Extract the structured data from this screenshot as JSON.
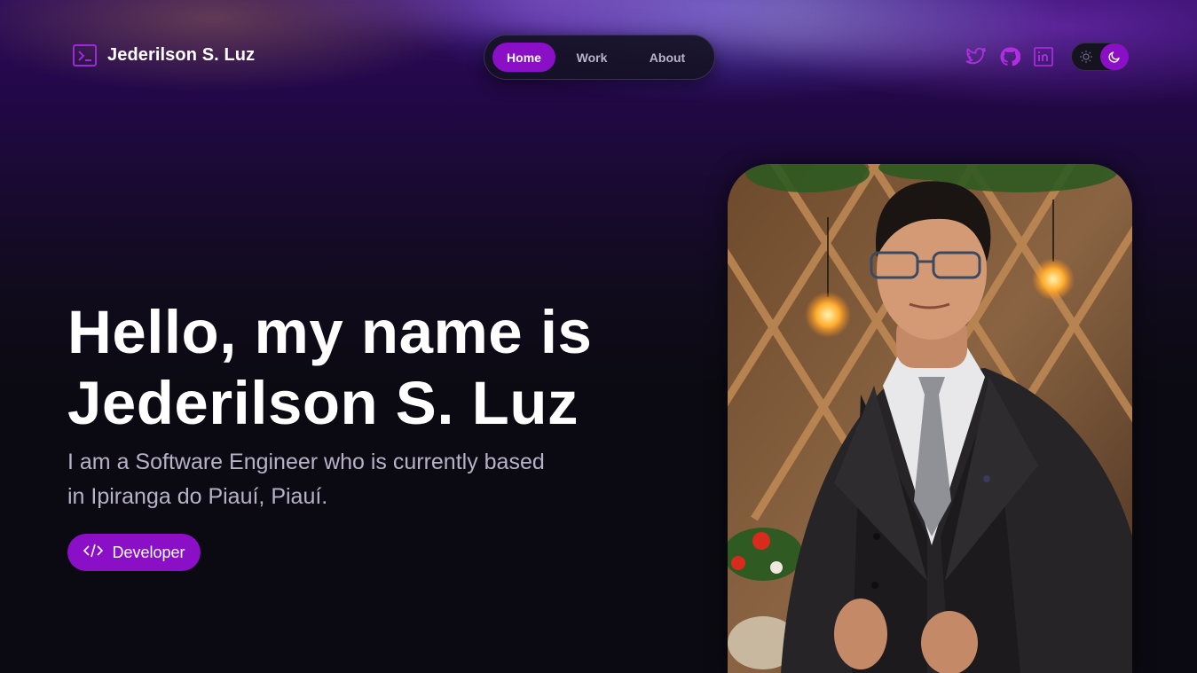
{
  "brand": {
    "name": "Jederilson S. Luz",
    "icon": "terminal-icon"
  },
  "nav": {
    "items": [
      {
        "label": "Home",
        "active": true
      },
      {
        "label": "Work",
        "active": false
      },
      {
        "label": "About",
        "active": false
      }
    ]
  },
  "socials": [
    {
      "name": "twitter-icon"
    },
    {
      "name": "github-icon"
    },
    {
      "name": "linkedin-icon"
    }
  ],
  "theme_toggle": {
    "mode": "dark",
    "icons": [
      "sun-icon",
      "moon-icon"
    ]
  },
  "hero": {
    "title_line1": "Hello, my name is",
    "title_line2": "Jederilson S. Luz",
    "subtitle_line1": "I am a Software Engineer who is currently based",
    "subtitle_line2": "in Ipiranga do Piauí, Piauí.",
    "badge_label": "Developer",
    "badge_icon": "code-icon"
  },
  "colors": {
    "accent": "#8a0fc7",
    "background": "#0b0a12",
    "muted_text": "#b7b2c8",
    "social_icon": "#b12ee0"
  }
}
